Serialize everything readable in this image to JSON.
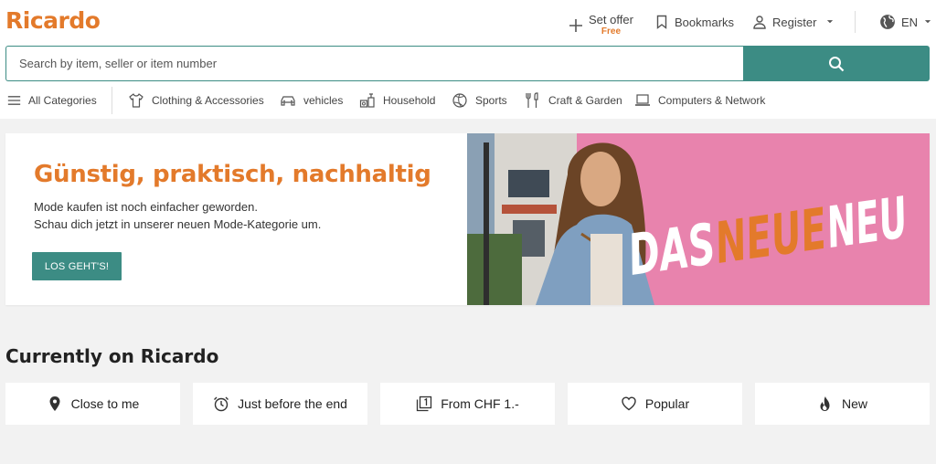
{
  "header": {
    "logo": "Ricardo",
    "actions": {
      "set_offer": "Set offer",
      "set_offer_badge": "Free",
      "bookmarks": "Bookmarks",
      "register": "Register",
      "language": "EN"
    }
  },
  "search": {
    "placeholder": "Search by item, seller or item number"
  },
  "categories": [
    {
      "label": "All Categories",
      "icon": "menu-icon"
    },
    {
      "label": "Clothing & Accessories",
      "icon": "shirt-icon"
    },
    {
      "label": "vehicles",
      "icon": "car-icon"
    },
    {
      "label": "Household",
      "icon": "household-icon"
    },
    {
      "label": "Sports",
      "icon": "ball-icon"
    },
    {
      "label": "Craft & Garden",
      "icon": "tools-icon"
    },
    {
      "label": "Computers & Network",
      "icon": "laptop-icon"
    }
  ],
  "banner": {
    "title": "Günstig, praktisch, nachhaltig",
    "line1": "Mode kaufen ist noch einfacher geworden.",
    "line2": "Schau dich jetzt in unserer neuen Mode-Kategorie um.",
    "cta": "LOS GEHT'S!",
    "image_text": {
      "das": "DAS",
      "neue": "NEUE",
      "neu": "NEU"
    }
  },
  "section": {
    "title": "Currently on Ricardo",
    "cards": [
      {
        "label": "Close to me",
        "icon": "location-pin-icon"
      },
      {
        "label": "Just before the end",
        "icon": "alarm-clock-icon"
      },
      {
        "label": "From CHF 1.-",
        "icon": "price-one-icon"
      },
      {
        "label": "Popular",
        "icon": "heart-icon"
      },
      {
        "label": "New",
        "icon": "flame-icon"
      }
    ]
  },
  "colors": {
    "brand_orange": "#e37a2b",
    "brand_teal": "#3c8c84",
    "banner_pink": "#e47ea8"
  }
}
